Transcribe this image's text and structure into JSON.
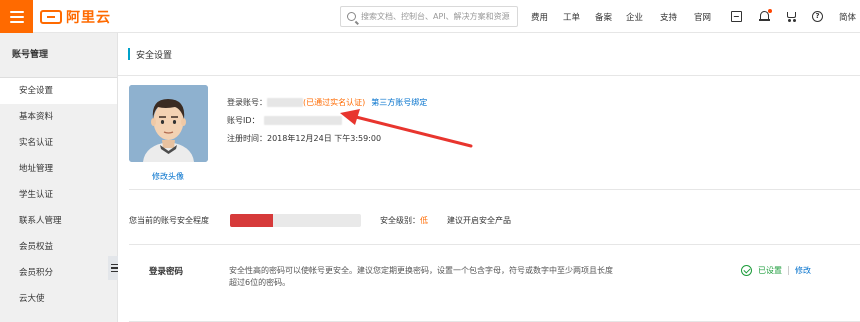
{
  "brand": {
    "name": "阿里云",
    "accent": "#ff6a00"
  },
  "search": {
    "placeholder": "搜索文档、控制台、API、解决方案和资源"
  },
  "nav": {
    "links": [
      "费用",
      "工单",
      "备案",
      "企业",
      "支持",
      "官网"
    ],
    "icons": [
      "console-icon",
      "bell-icon",
      "cart-icon",
      "help-icon"
    ],
    "language": "简体"
  },
  "sidebar": {
    "title": "账号管理",
    "items": [
      {
        "label": "安全设置",
        "active": true
      },
      {
        "label": "基本资料"
      },
      {
        "label": "实名认证"
      },
      {
        "label": "地址管理"
      },
      {
        "label": "学生认证"
      },
      {
        "label": "联系人管理"
      },
      {
        "label": "会员权益"
      },
      {
        "label": "会员积分"
      },
      {
        "label": "云大使"
      }
    ]
  },
  "page": {
    "title": "安全设置",
    "edit_avatar": "修改头像",
    "login_account_label": "登录账号：",
    "verified_text": "(已通过实名认证)",
    "third_party_link": "第三方账号绑定",
    "account_id_label": "账号ID：",
    "register_label": "注册时间：",
    "register_time": "2018年12月24日 下午3:59:00",
    "security_level_text": "您当前的账号安全程度",
    "security_progress": 0.33,
    "security_color": "#d63a3a",
    "level_label": "安全级别：",
    "level_value": "低",
    "suggest_link": "建议开启安全产品"
  },
  "password": {
    "title": "登录密码",
    "description": "安全性高的密码可以使帐号更安全。建议您定期更换密码，设置一个包含字母，符号或数字中至少两项且长度超过6位的密码。",
    "status": "已设置",
    "modify": "修改",
    "status_color": "#1e9d3c"
  }
}
